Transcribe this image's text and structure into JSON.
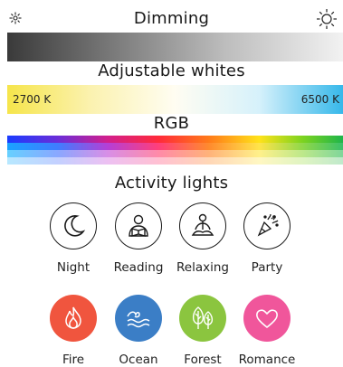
{
  "dimming": {
    "title": "Dimming",
    "left_icon": "dim-sun-icon",
    "right_icon": "bright-sun-icon"
  },
  "whites": {
    "title": "Adjustable whites",
    "min_label": "2700 K",
    "max_label": "6500 K"
  },
  "rgb": {
    "title": "RGB"
  },
  "activity": {
    "title": "Activity lights",
    "items": [
      {
        "label": "Night",
        "icon": "moon-icon"
      },
      {
        "label": "Reading",
        "icon": "reading-icon"
      },
      {
        "label": "Relaxing",
        "icon": "meditation-icon"
      },
      {
        "label": "Party",
        "icon": "party-popper-icon"
      },
      {
        "label": "Fire",
        "icon": "flame-icon",
        "color": "#f0553e"
      },
      {
        "label": "Ocean",
        "icon": "waves-icon",
        "color": "#3b7ec6"
      },
      {
        "label": "Forest",
        "icon": "trees-icon",
        "color": "#8bc53f"
      },
      {
        "label": "Romance",
        "icon": "heart-icon",
        "color": "#f0569b"
      }
    ]
  }
}
